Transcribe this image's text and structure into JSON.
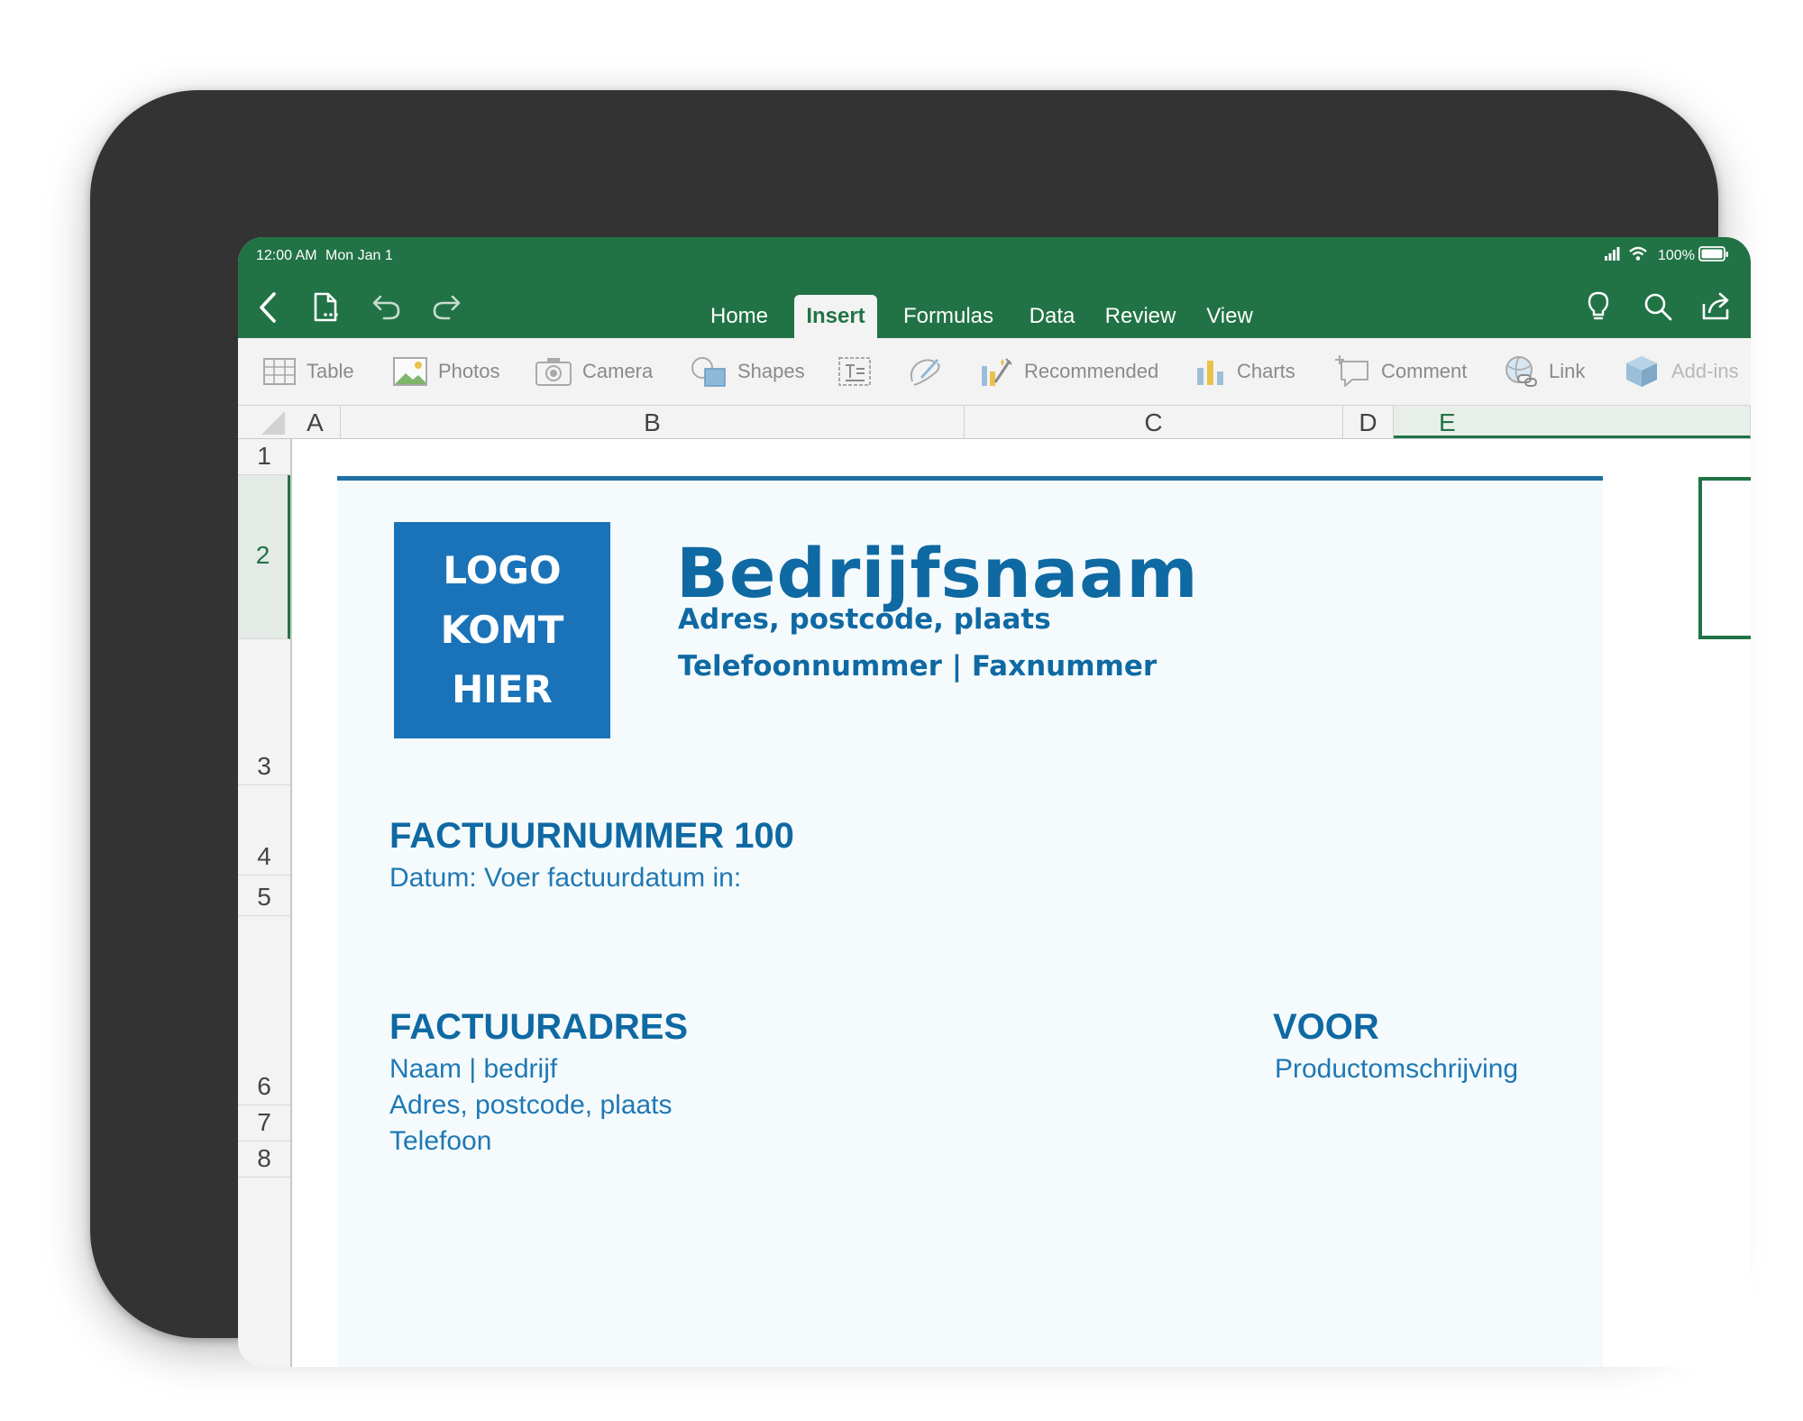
{
  "status": {
    "time": "12:00 AM",
    "date": "Mon Jan 1",
    "battery": "100%"
  },
  "toolbar": {
    "back_icon": "chevron-left-icon",
    "file_icon": "file-icon",
    "undo_icon": "undo-icon",
    "redo_icon": "redo-icon",
    "tell_me_icon": "lightbulb-icon",
    "search_icon": "search-icon",
    "share_icon": "share-icon"
  },
  "tabs": [
    {
      "label": "Home"
    },
    {
      "label": "Insert",
      "active": true
    },
    {
      "label": "Formulas"
    },
    {
      "label": "Data"
    },
    {
      "label": "Review"
    },
    {
      "label": "View"
    }
  ],
  "ribbon": {
    "table": "Table",
    "photos": "Photos",
    "camera": "Camera",
    "shapes": "Shapes",
    "textbox_icon": "text-box-icon",
    "drawing_icon": "drawing-icon",
    "recommended": "Recommended",
    "charts": "Charts",
    "comment": "Comment",
    "link": "Link",
    "addins": "Add-ins"
  },
  "columns": [
    "A",
    "B",
    "C",
    "D",
    "E"
  ],
  "rows": [
    "1",
    "2",
    "3",
    "4",
    "5",
    "6",
    "7",
    "8"
  ],
  "sheet": {
    "logo": [
      "LOGO",
      "KOMT",
      "HIER"
    ],
    "company_name": "Bedrijfsnaam",
    "address": "Adres, postcode, plaats",
    "phone_fax": "Telefoonnummer | Faxnummer",
    "invoice_number": "FACTUURNUMMER 100",
    "date_prompt": "Datum: Voer factuurdatum in:",
    "billing_heading": "FACTUURADRES",
    "billing_name": "Naam | bedrijf",
    "billing_address": "Adres, postcode, plaats",
    "billing_phone": "Telefoon",
    "for_heading": "VOOR",
    "for_description": "Productomschrijving"
  },
  "colors": {
    "excel_green": "#217346",
    "doc_blue": "#0f69a3",
    "logo_blue": "#1a73b8"
  }
}
